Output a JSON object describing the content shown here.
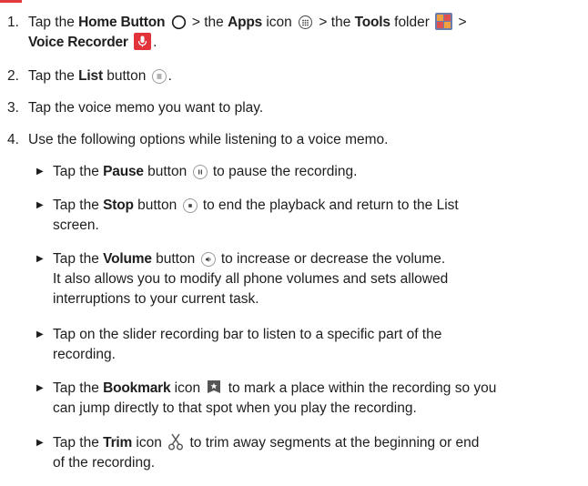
{
  "steps": [
    {
      "num": "1.",
      "t1": "Tap the ",
      "b1": "Home Button",
      "t2": " > the ",
      "b2": "Apps",
      "t3": " icon ",
      "t4": " > the ",
      "b3": "Tools",
      "t5": " folder ",
      "t6": " >",
      "b4": "Voice Recorder",
      "t7": "."
    },
    {
      "num": "2.",
      "t1": "Tap the ",
      "b1": "List",
      "t2": " button ",
      "t3": "."
    },
    {
      "num": "3.",
      "t1": "Tap the voice memo you want to play."
    },
    {
      "num": "4.",
      "t1": "Use the following options while listening to a voice memo."
    }
  ],
  "bullets": [
    {
      "t1": "Tap the ",
      "b1": "Pause",
      "t2": " button ",
      "t3": " to pause the recording."
    },
    {
      "t1": "Tap the ",
      "b1": "Stop",
      "t2": " button ",
      "t3": " to end the playback and return to the List",
      "l2": "screen."
    },
    {
      "t1": "Tap the ",
      "b1": "Volume",
      "t2": " button ",
      "t3": " to increase or decrease the volume.",
      "l2": "It also allows you to modify all phone volumes and sets allowed",
      "l3": "interruptions to your current task."
    },
    {
      "t1": "Tap on the slider recording bar to listen to a specific part of the",
      "l2": "recording."
    },
    {
      "t1": "Tap the ",
      "b1": "Bookmark",
      "t2": " icon ",
      "t3": " to mark a place within the recording so you",
      "l2": "can jump directly to that spot when you play the recording."
    },
    {
      "t1": "Tap the ",
      "b1": "Trim",
      "t2": " icon ",
      "t3": " to trim away segments at the beginning or end",
      "l2": "of the recording."
    }
  ],
  "colors": {
    "accent": "#e23b3b",
    "mic_red": "#e2323a",
    "text": "#1e1e1e"
  },
  "icons": [
    "home-button-icon",
    "apps-icon",
    "tools-folder-icon",
    "voice-recorder-icon",
    "list-button-icon",
    "pause-button-icon",
    "stop-button-icon",
    "volume-button-icon",
    "bookmark-icon",
    "trim-icon"
  ]
}
